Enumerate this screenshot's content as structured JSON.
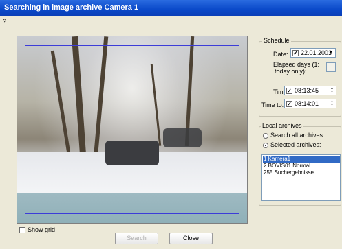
{
  "window": {
    "title": "Searching in image archive Camera 1",
    "help": "?"
  },
  "preview": {
    "show_grid_label": "Show grid",
    "show_grid_checked": false
  },
  "schedule": {
    "label": "Schedule",
    "date_label": "Date:",
    "date_value": "22.01.2003",
    "date_checked": true,
    "elapsed_label_1": "Elapsed days (1:",
    "elapsed_label_2": "today only):",
    "time_label": "Time",
    "time_value": "08:13:45",
    "time_checked": true,
    "time_to_label": "Time to:",
    "time_to_value": "08:14:01",
    "time_to_checked": true
  },
  "archives": {
    "label": "Local archives",
    "search_all_label": "Search all archives",
    "selected_label": "Selected archives:",
    "selected_option": "selected",
    "items": [
      {
        "label": "1  Kamera1",
        "selected": true
      },
      {
        "label": "2  BOVIS01 Normal",
        "selected": false
      },
      {
        "label": "255  Suchergebnisse",
        "selected": false
      }
    ]
  },
  "buttons": {
    "search_label": "Search",
    "close_label": "Close"
  }
}
